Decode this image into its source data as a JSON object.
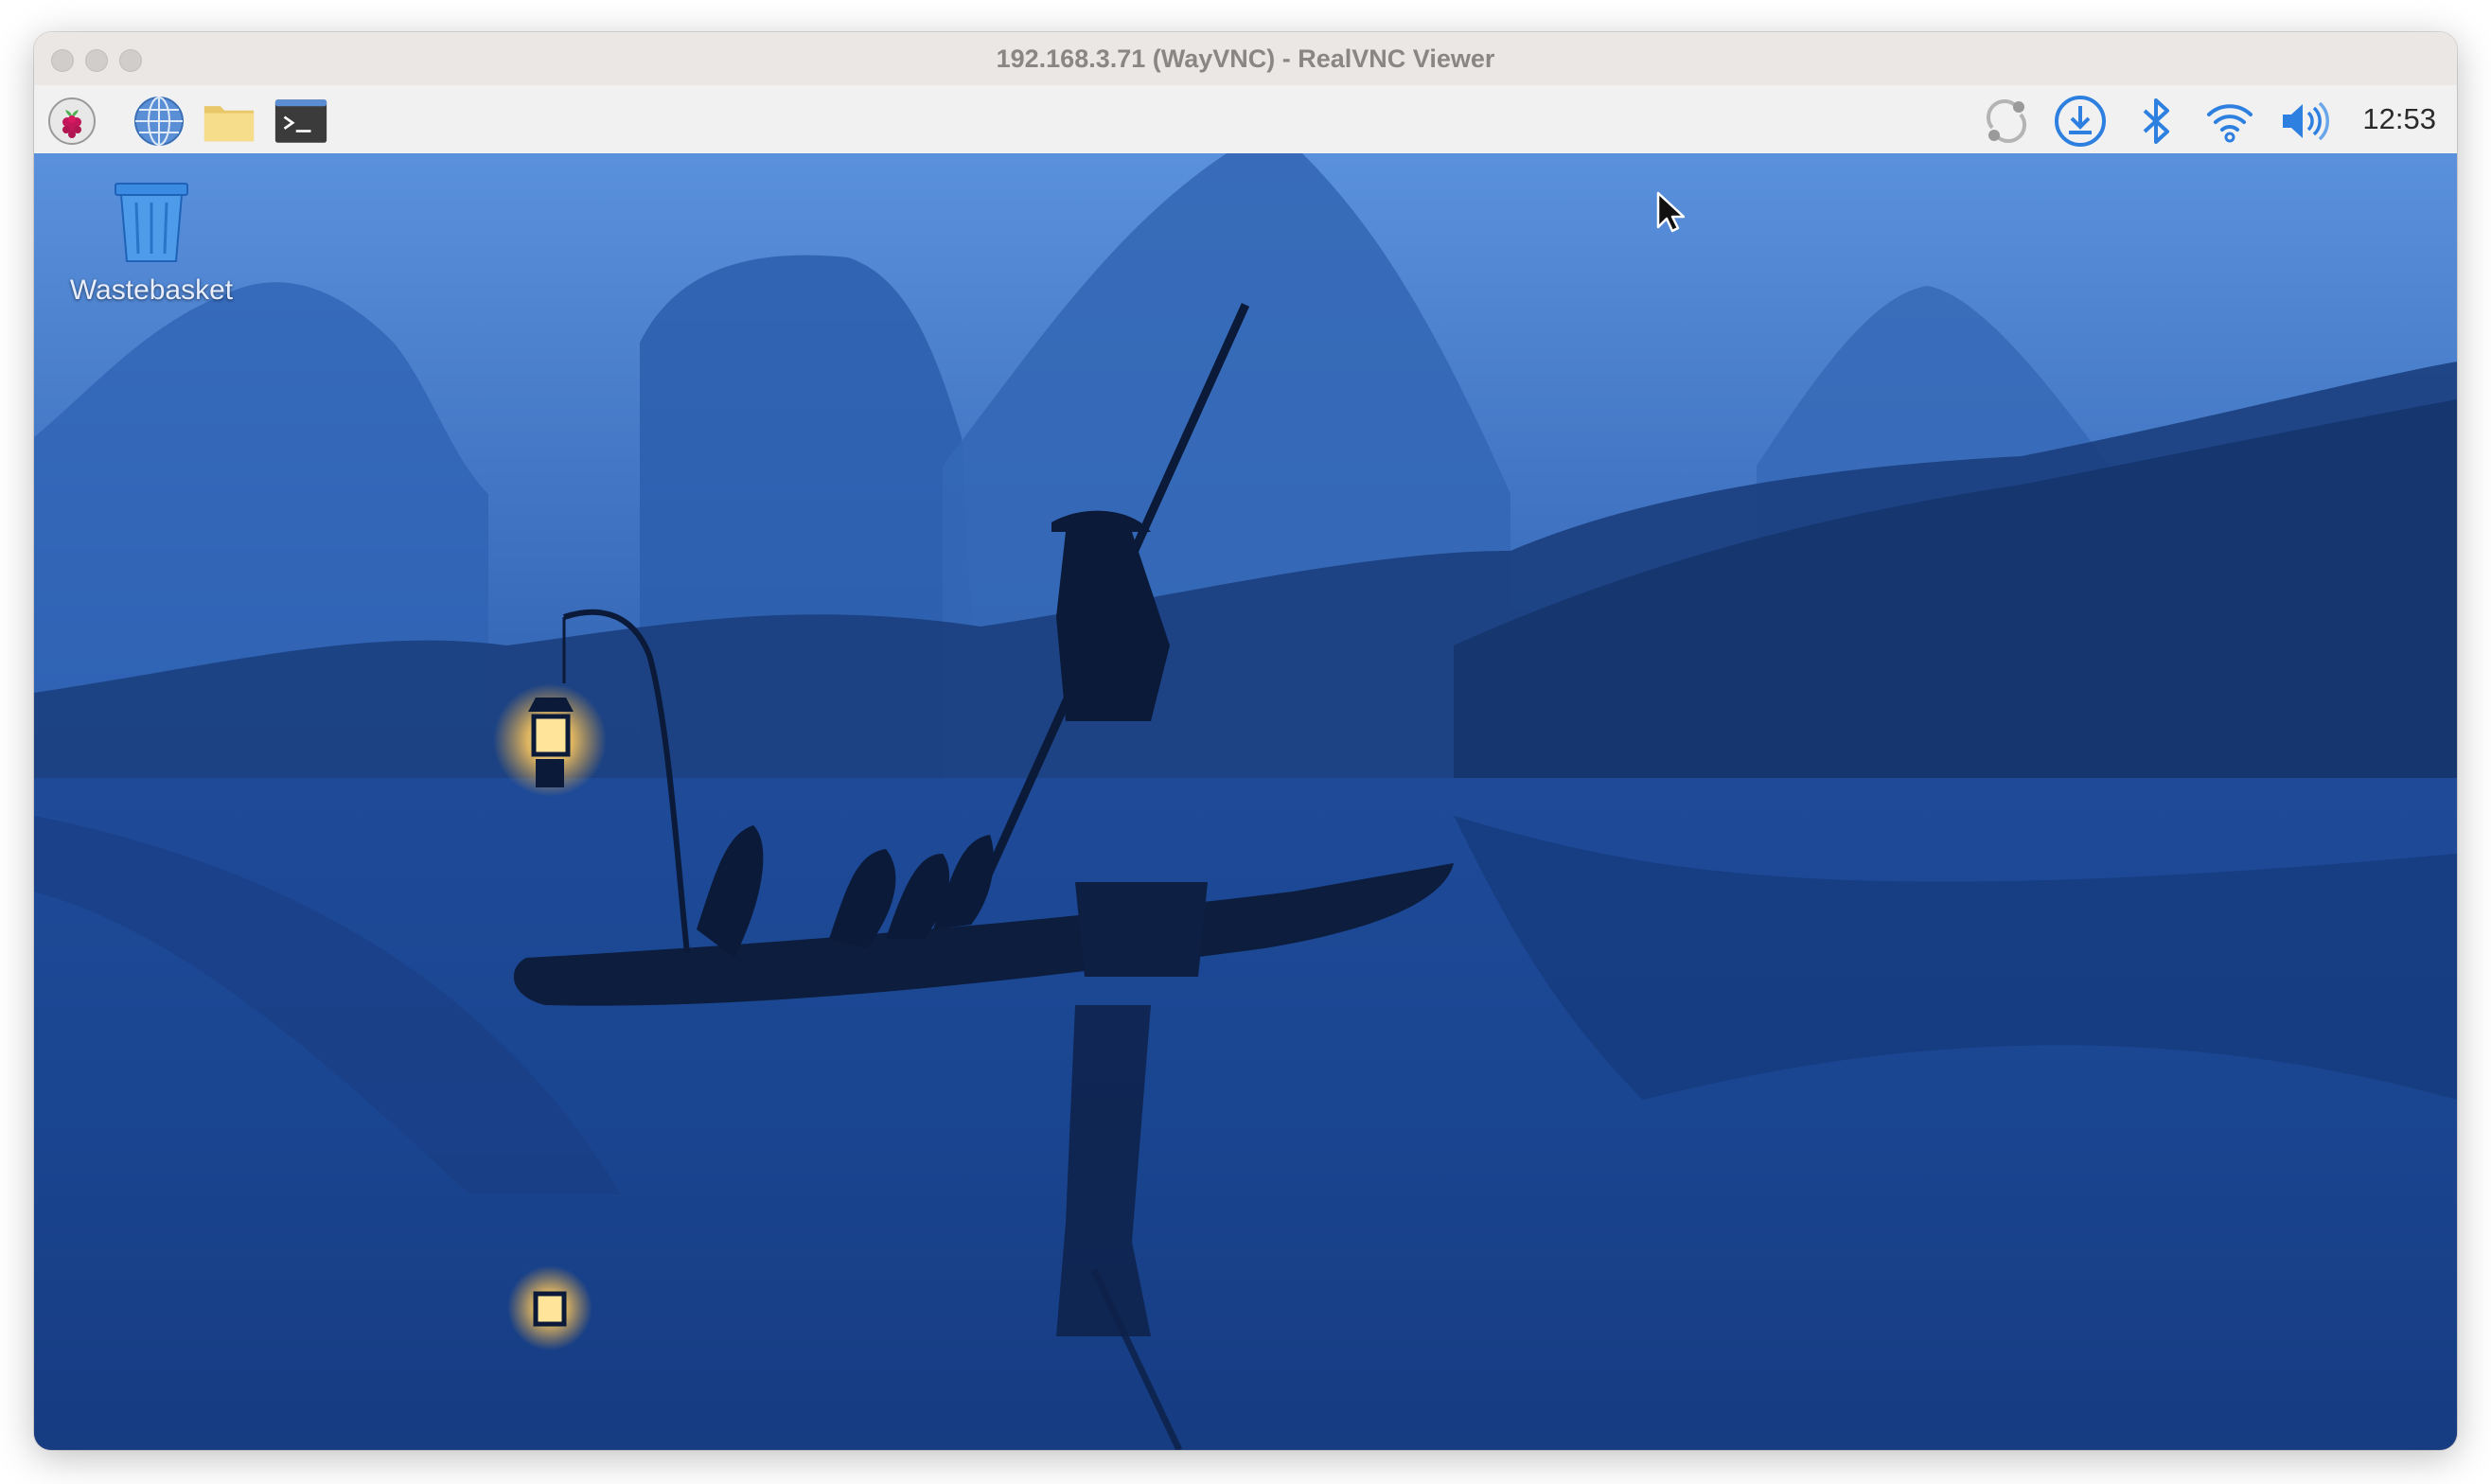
{
  "window": {
    "title": "192.168.3.71 (WayVNC) - RealVNC Viewer"
  },
  "taskbar": {
    "launchers": [
      {
        "icon": "raspberry-pi-menu-icon"
      },
      {
        "icon": "web-browser-icon"
      },
      {
        "icon": "file-manager-icon"
      },
      {
        "icon": "terminal-icon"
      }
    ],
    "tray": [
      {
        "icon": "updater-sync-icon"
      },
      {
        "icon": "download-updates-icon"
      },
      {
        "icon": "bluetooth-icon"
      },
      {
        "icon": "wifi-icon"
      },
      {
        "icon": "volume-icon"
      }
    ],
    "clock": "12:53"
  },
  "desktop": {
    "icons": [
      {
        "label": "Wastebasket",
        "icon": "wastebasket-icon"
      }
    ]
  },
  "colors": {
    "accent": "#2d7fe0",
    "taskbar_bg": "#f1f1f1",
    "titlebar_bg": "#ebe7e5"
  }
}
